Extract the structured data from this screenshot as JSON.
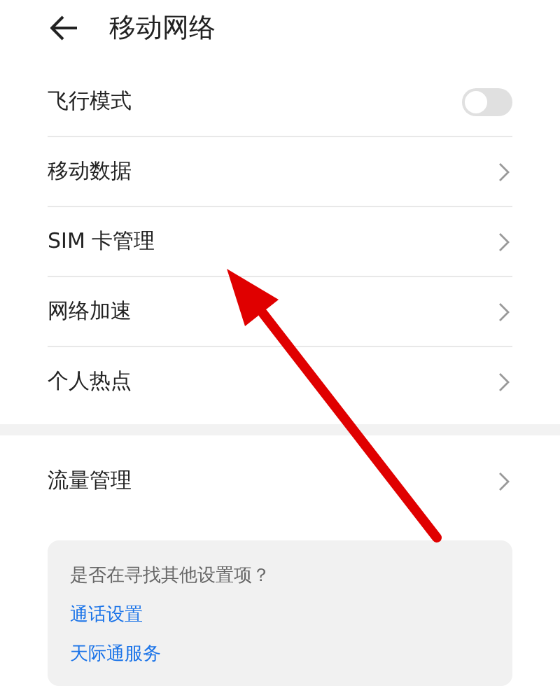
{
  "header": {
    "title": "移动网络"
  },
  "groups": [
    {
      "items": [
        {
          "kind": "toggle",
          "label": "飞行模式",
          "checked": false
        },
        {
          "kind": "link",
          "label": "移动数据"
        },
        {
          "kind": "link",
          "label": "SIM 卡管理"
        },
        {
          "kind": "link",
          "label": "网络加速"
        },
        {
          "kind": "link",
          "label": "个人热点"
        }
      ]
    },
    {
      "items": [
        {
          "kind": "link",
          "label": "流量管理"
        }
      ]
    }
  ],
  "suggestions": {
    "question": "是否在寻找其他设置项？",
    "links": [
      "通话设置",
      "天际通服务"
    ]
  }
}
